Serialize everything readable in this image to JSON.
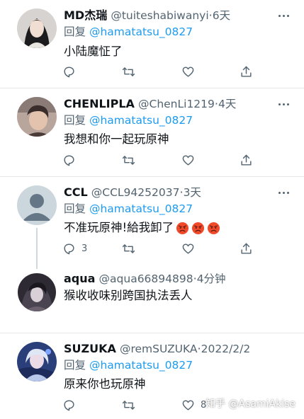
{
  "reply_prefix": "回复",
  "tweets": [
    {
      "name": "MD杰瑞",
      "handle": "@tuiteshabiwanyi",
      "time": "6天",
      "reply_to": "@hamatatsu_0827",
      "text": "小陆魔怔了",
      "reply_count": "",
      "like_count": ""
    },
    {
      "name": "CHENLIPLA",
      "handle": "@ChenLi1219",
      "time": "4天",
      "reply_to": "@hamatatsu_0827",
      "text": "我想和你一起玩原神",
      "reply_count": "",
      "like_count": ""
    },
    {
      "name": "CCL",
      "handle": "@CCL94252037",
      "time": "3天",
      "reply_to": "@hamatatsu_0827",
      "text": "不准玩原神!給我卸了",
      "emoji_count": 3,
      "reply_count": "3",
      "like_count": ""
    },
    {
      "name": "aqua",
      "handle": "@aqua66894898",
      "time": "4分钟",
      "text": "猴收收味别跨国执法丢人"
    },
    {
      "name": "SUZUKA",
      "handle": "@remSUZUKA",
      "time": "2022/2/2",
      "reply_to": "@hamatatsu_0827",
      "text": "原来你也玩原神",
      "reply_count": "",
      "like_count": "8"
    }
  ],
  "watermark": "知乎 @AsamiAkise",
  "icons": {
    "reply": "comment-bubble-icon",
    "retweet": "retweet-icon",
    "like": "heart-icon",
    "share": "share-icon",
    "more": "more-dots-icon",
    "emoji": "angry-face-emoji"
  },
  "colors": {
    "mention": "#1d9bf0",
    "secondary_text": "#536471",
    "primary_text": "#0f1419",
    "divider": "#e6e9ec"
  }
}
